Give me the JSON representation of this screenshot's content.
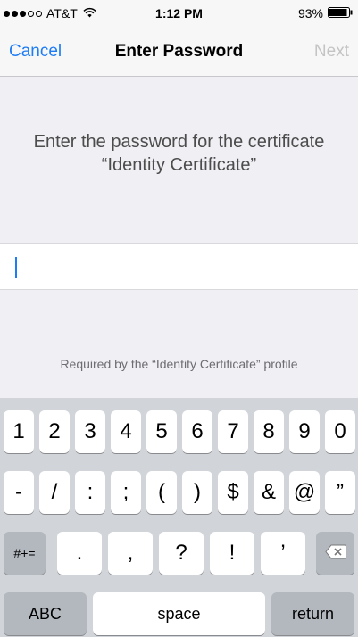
{
  "status_bar": {
    "signal_full": 3,
    "signal_empty": 2,
    "carrier": "AT&T",
    "time": "1:12 PM",
    "battery_percent": "93%",
    "battery_level": 0.93
  },
  "nav": {
    "cancel_label": "Cancel",
    "title": "Enter Password",
    "next_label": "Next"
  },
  "prompt": {
    "line1": "Enter the password for the certificate",
    "line2": "“Identity Certificate”"
  },
  "password_field": {
    "value": ""
  },
  "footnote": "Required by the “Identity Certificate” profile",
  "keyboard": {
    "row1": [
      "1",
      "2",
      "3",
      "4",
      "5",
      "6",
      "7",
      "8",
      "9",
      "0"
    ],
    "row2": [
      "-",
      "/",
      ":",
      ";",
      "(",
      ")",
      "$",
      "&",
      "@",
      "”"
    ],
    "row3_left": "#+=",
    "row3": [
      ".",
      ",",
      "?",
      "!",
      "’"
    ],
    "abc_label": "ABC",
    "space_label": "space",
    "return_label": "return"
  },
  "colors": {
    "accent": "#1e7cf4",
    "disabled": "#c4c4c6",
    "background": "#efeff4",
    "keyboard": "#d1d4d9"
  },
  "icons": {
    "wifi": "wifi-icon",
    "battery": "battery-icon",
    "delete": "delete-icon"
  }
}
